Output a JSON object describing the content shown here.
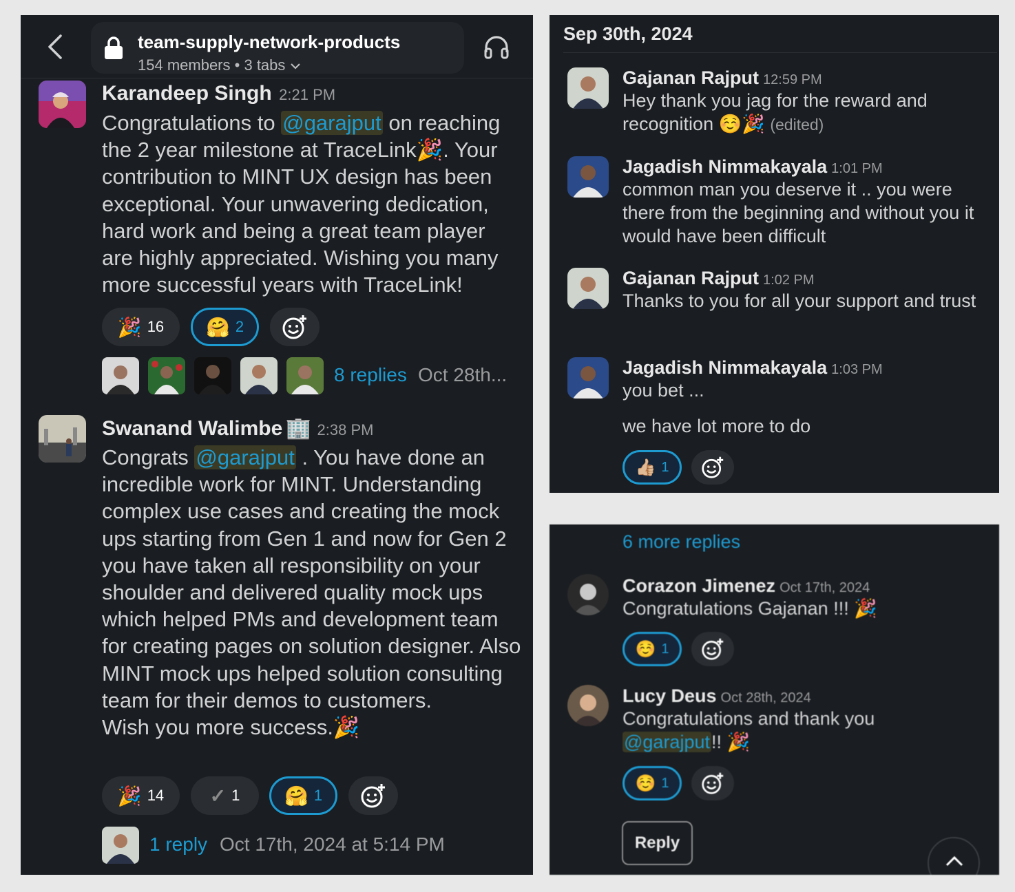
{
  "header": {
    "channel_name": "team-supply-network-products",
    "members": "154 members",
    "dot": "•",
    "tabs": "3 tabs"
  },
  "left_messages": [
    {
      "author": "Karandeep Singh",
      "time": "2:21 PM",
      "text_before": "Congratulations to ",
      "mention": "@garajput",
      "text_after": " on reaching the 2 year milestone at TraceLink🎉. Your contribution to MINT UX design has been exceptional. Your unwavering dedication, hard work and being a great team player are highly appreciated. Wishing you many more successful years with TraceLink!",
      "reactions": [
        {
          "emoji": "🎉",
          "count": "16",
          "selected": false
        },
        {
          "emoji": "🤗",
          "count": "2",
          "selected": true
        }
      ],
      "replies": "8 replies",
      "reply_date": "Oct 28th..."
    },
    {
      "author": "Swanand Walimbe",
      "status_emoji": "🏢",
      "time": "2:38 PM",
      "text_before": "Congrats ",
      "mention": "@garajput",
      "text_after": " . You have done an incredible work for MINT.  Understanding complex use cases and creating the  mock ups starting from Gen 1 and now for Gen 2 you have taken all responsibility on your shoulder and delivered quality mock ups which helped PMs and development team for creating pages on solution designer. Also MINT mock ups helped solution consulting team for their demos to customers.",
      "text_last": "Wish you more success.🎉",
      "reactions": [
        {
          "emoji": "🎉",
          "count": "14",
          "selected": false
        },
        {
          "emoji": "✓",
          "count": "1",
          "selected": false
        },
        {
          "emoji": "🤗",
          "count": "1",
          "selected": true
        }
      ],
      "replies": "1 reply",
      "reply_date": "Oct 17th, 2024 at 5:14 PM"
    }
  ],
  "thread_top": {
    "date": "Sep 30th, 2024",
    "messages": [
      {
        "author": "Gajanan Rajput",
        "time": "12:59 PM",
        "text": "Hey thank you jag for the reward and recognition ☺️🎉",
        "edited": "(edited)"
      },
      {
        "author": "Jagadish Nimmakayala",
        "time": "1:01 PM",
        "text": "common man you deserve it .. you were there from the beginning and without you it would have been difficult"
      },
      {
        "author": "Gajanan Rajput",
        "time": "1:02 PM",
        "text": "Thanks to you for all your support and trust"
      },
      {
        "author": "Jagadish Nimmakayala",
        "time": "1:03 PM",
        "text": "you bet ...",
        "text2": "we have lot more to do",
        "reaction": {
          "emoji": "👍🏼",
          "count": "1"
        }
      }
    ]
  },
  "thread_bottom": {
    "more_replies": "6 more replies",
    "messages": [
      {
        "author": "Corazon Jimenez",
        "time": "Oct 17th, 2024",
        "text": "Congratulations Gajanan !!! 🎉",
        "reaction": {
          "emoji": "☺️",
          "count": "1"
        }
      },
      {
        "author": "Lucy Deus",
        "time": "Oct 28th, 2024",
        "text": "Congratulations and thank you ",
        "mention": "@garajput",
        "text_after": "!! 🎉",
        "reaction": {
          "emoji": "☺️",
          "count": "1"
        }
      }
    ],
    "reply_button": "Reply"
  },
  "colors": {
    "background": "#1a1d21",
    "accent": "#1d9bd1",
    "page": "#e8e8e8"
  }
}
